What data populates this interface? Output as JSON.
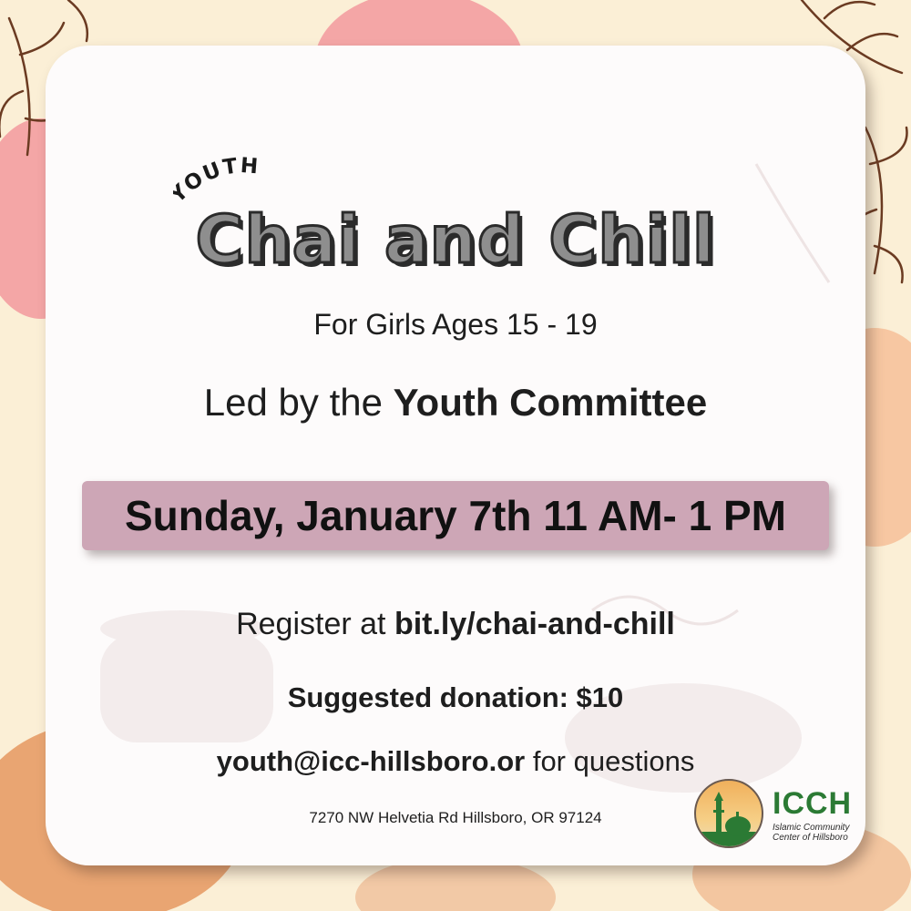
{
  "poster": {
    "kicker": "YOUTH",
    "title": "Chai and Chill",
    "audience": "For Girls Ages 15 - 19",
    "led_prefix": "Led by the",
    "led_by": "Youth Committee",
    "date_time": "Sunday, January 7th 11 AM- 1 PM",
    "register_prefix": "Register at",
    "register_url": "bit.ly/chai-and-chill",
    "donation": "Suggested donation: $10",
    "email": "youth@icc-hillsboro.or",
    "email_suffix": "for questions",
    "address": "7270 NW Helvetia Rd Hillsboro, OR 97124"
  },
  "logo": {
    "abbr": "ICCH",
    "name_line1": "Islamic Community",
    "name_line2": "Center of Hillsboro"
  },
  "colors": {
    "background": "#fbefd6",
    "banner": "#cda6b6",
    "logo_green": "#2b7a34",
    "accent_pink": "#f4a6a6",
    "accent_peach": "#f7c7a2"
  }
}
